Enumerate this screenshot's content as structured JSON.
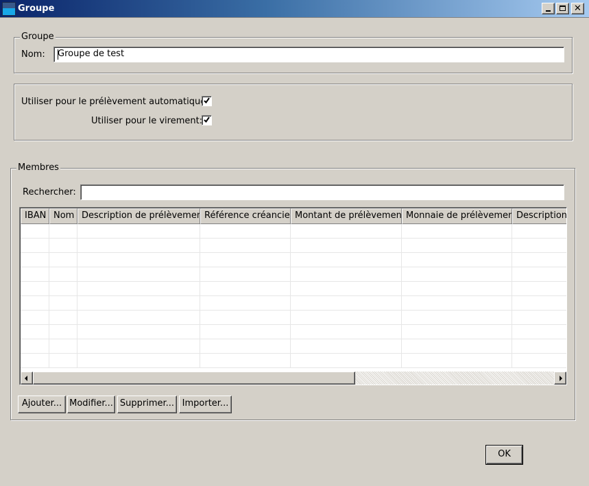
{
  "window": {
    "title": "Groupe",
    "minimize": "minimize",
    "maximize": "maximize",
    "close": "close"
  },
  "group": {
    "legend": "Groupe",
    "name_label": "Nom:",
    "name_value": "Groupe de test"
  },
  "options": {
    "auto_debit_label": "Utiliser pour le prélèvement automatique:",
    "auto_debit_checked": true,
    "transfer_label": "Utiliser pour le virement:",
    "transfer_checked": true
  },
  "members": {
    "legend": "Membres",
    "search_label": "Rechercher:",
    "search_value": "",
    "columns": [
      "IBAN",
      "Nom",
      "Description de prélèvement",
      "Référence créancier",
      "Montant de prélèvement",
      "Monnaie de prélèvement",
      "Description d"
    ],
    "rows": [],
    "buttons": {
      "add": "Ajouter...",
      "edit": "Modifier...",
      "delete": "Supprimer...",
      "import": "Importer..."
    }
  },
  "footer": {
    "ok": "OK"
  }
}
